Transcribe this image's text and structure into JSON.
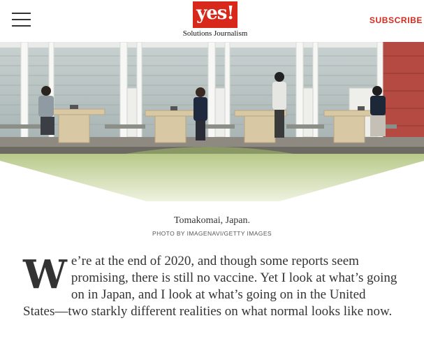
{
  "header": {
    "menu_icon": "hamburger-menu-icon",
    "logo_text": "yes!",
    "logo_subtitle": "Solutions Journalism",
    "subscribe_label": "SUBSCRIBE",
    "colors": {
      "brand_red": "#d8281c"
    }
  },
  "hero": {
    "caption": "Tomakomai, Japan.",
    "credit": "PHOTO BY IMAGENAVI/GETTY IMAGES"
  },
  "article": {
    "dropcap": "W",
    "body": "e’re at the end of 2020, and though some reports seem promising, there is still no vaccine. Yet I look at what’s going on in Japan, and I look at what’s going on in the United States—two starkly different realities on what normal looks like now."
  }
}
